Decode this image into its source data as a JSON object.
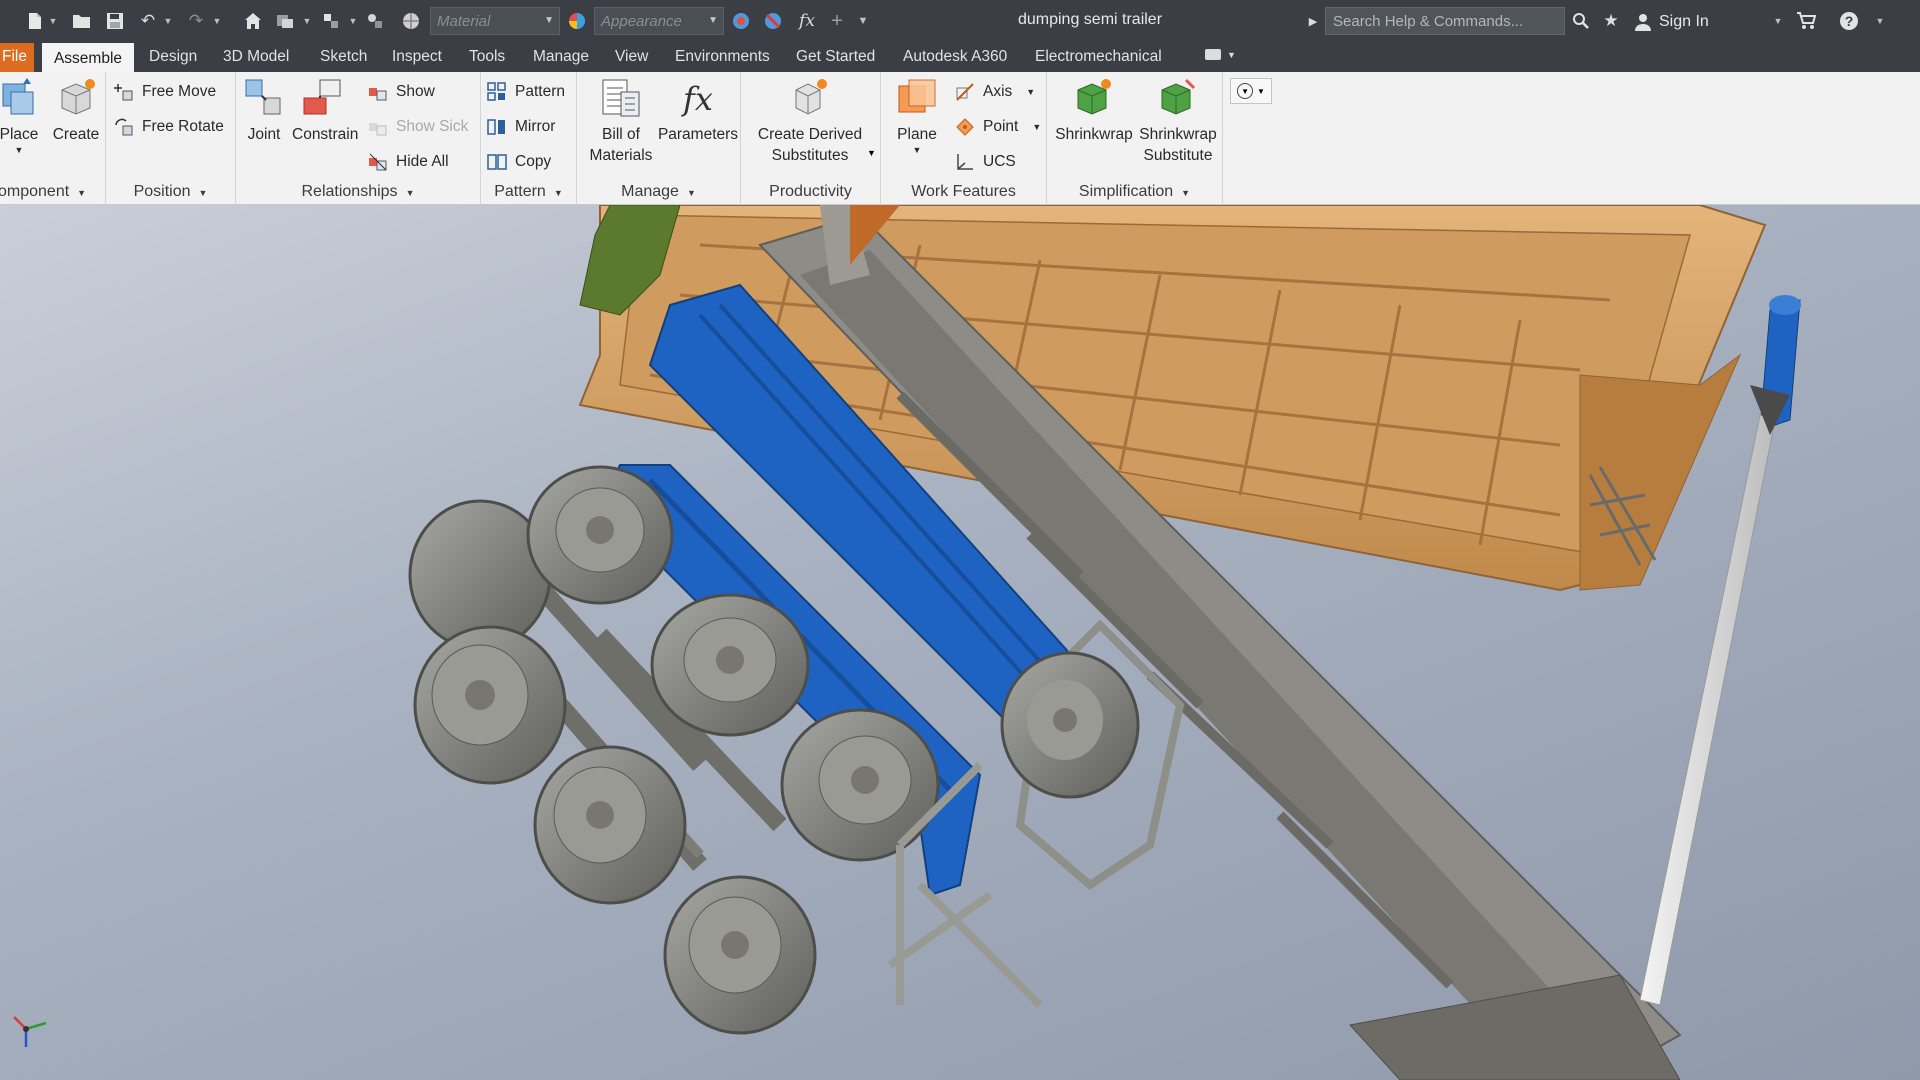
{
  "window": {
    "title": "dumping semi trailer",
    "material_placeholder": "Material",
    "appearance_placeholder": "Appearance",
    "search_placeholder": "Search Help & Commands...",
    "sign_in": "Sign In"
  },
  "tabs": [
    "File",
    "Assemble",
    "Design",
    "3D Model",
    "Sketch",
    "Inspect",
    "Tools",
    "Manage",
    "View",
    "Environments",
    "Get Started",
    "Autodesk A360",
    "Electromechanical"
  ],
  "active_tab": "Assemble",
  "ribbon": {
    "component": {
      "title": "omponent",
      "place": "Place",
      "create": "Create"
    },
    "position": {
      "title": "Position",
      "free_move": "Free Move",
      "free_rotate": "Free Rotate"
    },
    "relationships": {
      "title": "Relationships",
      "joint": "Joint",
      "constrain": "Constrain",
      "show": "Show",
      "show_sick": "Show Sick",
      "hide_all": "Hide All"
    },
    "pattern": {
      "title": "Pattern",
      "pattern": "Pattern",
      "mirror": "Mirror",
      "copy": "Copy"
    },
    "manage": {
      "title": "Manage",
      "bom_1": "Bill of",
      "bom_2": "Materials",
      "parameters": "Parameters"
    },
    "productivity": {
      "title": "Productivity",
      "derived_1": "Create Derived",
      "derived_2": "Substitutes"
    },
    "work_features": {
      "title": "Work Features",
      "plane": "Plane",
      "axis": "Axis",
      "point": "Point",
      "ucs": "UCS"
    },
    "simplification": {
      "title": "Simplification",
      "shrinkwrap": "Shrinkwrap",
      "sub_1": "Shrinkwrap",
      "sub_2": "Substitute"
    }
  },
  "icons": [
    "new-icon",
    "open-icon",
    "save-icon",
    "undo-icon",
    "redo-icon",
    "home-icon",
    "search-icon",
    "star-icon",
    "user-icon",
    "cart-icon",
    "help-icon"
  ],
  "colors": {
    "titlebar": "#3b3f45",
    "file_tab": "#dd6b21",
    "ribbon": "#f2f2f2",
    "trailer_body": "#d9a66b",
    "chassis": "#8e8c86",
    "blue_parts": "#1f63c2",
    "green_part": "#5b7a2e",
    "wheels": "#8a8a86"
  }
}
